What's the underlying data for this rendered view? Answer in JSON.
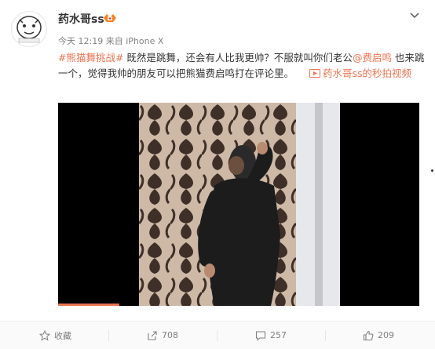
{
  "post": {
    "username": "药水哥ss",
    "time": "今天 12:19",
    "source_prefix": "来自",
    "source": "iPhone X",
    "hashtag": "#熊猫舞挑战#",
    "text1": " 既然是跳舞，还会有人比我更帅？不服就叫你们老公",
    "mention": "@费启鸣",
    "text2": " 也来跳一个，觉得我帅的朋友可以把熊猫费启鸣打在评论里。",
    "video_link": "药水哥ss的秒拍视频",
    "video_progress": 0.17
  },
  "actions": {
    "favorite": "收藏",
    "repost": "708",
    "comment": "257",
    "like": "209"
  },
  "colors": {
    "link": "#eb7350",
    "text": "#333333",
    "muted": "#808080"
  },
  "icons": [
    "avatar-cartoon",
    "vip-badge-icon",
    "chevron-down-icon",
    "video-play-icon",
    "star-icon",
    "repost-icon",
    "comment-icon",
    "thumbs-up-icon"
  ]
}
